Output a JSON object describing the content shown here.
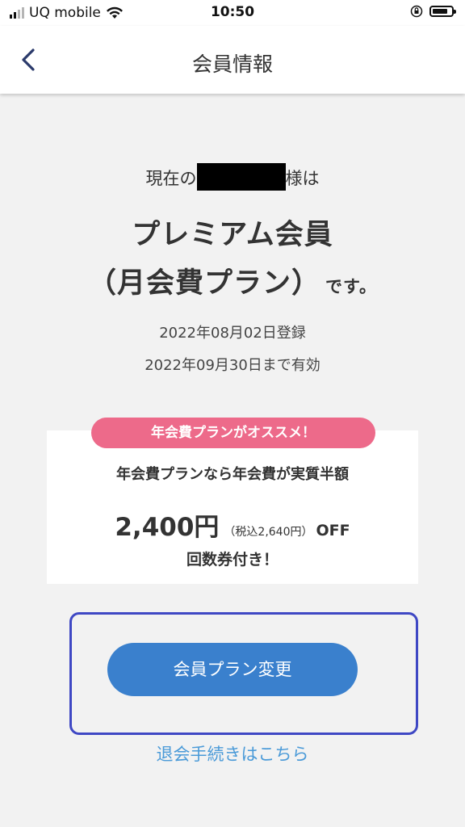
{
  "status_bar": {
    "carrier": "UQ mobile",
    "time": "10:50",
    "icons": [
      "signal-icon",
      "wifi-icon",
      "orientation-lock-icon",
      "battery-icon"
    ]
  },
  "header": {
    "title": "会員情報",
    "back_icon": "chevron-left-icon"
  },
  "membership": {
    "prefix": "現在の",
    "suffix": "様は",
    "plan_name": "プレミアム会員",
    "plan_type": "（月会費プラン）",
    "desu": "です。",
    "registered": "2022年08月02日登録",
    "valid_until": "2022年09月30日まで有効"
  },
  "promo": {
    "badge": "年会費プランがオススメ！",
    "line": "年会費プランなら年会費が実質半額",
    "amount": "2,400円",
    "tax_note": "（税込2,640円）",
    "off": "OFF",
    "extra": "回数券付き！",
    "badge_color": "#ed6a8a"
  },
  "actions": {
    "change_plan": "会員プラン変更",
    "withdraw": "退会手続きはこちら",
    "button_color": "#3a80cd",
    "link_color": "#4a9ad8",
    "highlight_color": "#3f48c4"
  }
}
